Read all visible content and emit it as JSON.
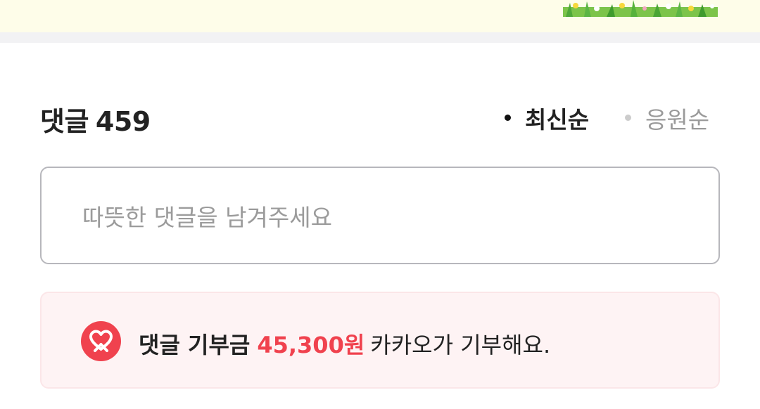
{
  "comments": {
    "title": "댓글",
    "count": "459",
    "sort_options": [
      {
        "label": "최신순",
        "selected": true
      },
      {
        "label": "응원순",
        "selected": false
      }
    ],
    "input": {
      "placeholder": "따뜻한 댓글을 남겨주세요"
    }
  },
  "donation": {
    "icon": "heart-ribbon-icon",
    "label": "댓글 기부금",
    "amount": "45,300원",
    "suffix": "카카오가 기부해요."
  },
  "colors": {
    "banner_bg": "#fefde9",
    "accent_red": "#f0424e",
    "donation_bg": "#fef3f4",
    "input_border": "#b7b7bc"
  }
}
